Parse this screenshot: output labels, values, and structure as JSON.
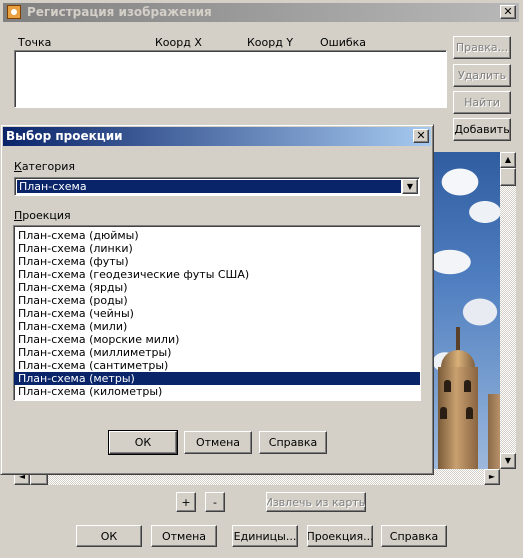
{
  "outer_window": {
    "title": "Регистрация изображения",
    "close_glyph": "✕",
    "columns": [
      "Точка",
      "Коорд X",
      "Коорд Y",
      "Ошибка"
    ],
    "side_buttons": {
      "help": "Правка...",
      "delete": "Удалить",
      "find": "Найти",
      "add": "Добавить"
    },
    "zoom_in": "+",
    "zoom_out": "-",
    "extract_from_map": "Извлечь из карты",
    "bottom_buttons": {
      "ok": "ОК",
      "cancel": "Отмена",
      "units": "Единицы...",
      "projection": "Проекция...",
      "help": "Справка"
    }
  },
  "projection_dialog": {
    "title": "Выбор проекции",
    "close_glyph": "✕",
    "category_label_first": "К",
    "category_label_rest": "атегория",
    "category_value": "План-схема",
    "projection_label_first": "П",
    "projection_label_rest": "роекция",
    "projections": [
      "План-схема (дюймы)",
      "План-схема (линки)",
      "План-схема (футы)",
      "План-схема (геодезические футы США)",
      "План-схема (ярды)",
      "План-схема (роды)",
      "План-схема (чейны)",
      "План-схема (мили)",
      "План-схема (морские мили)",
      "План-схема (миллиметры)",
      "План-схема (сантиметры)",
      "План-схема (метры)",
      "План-схема (километры)"
    ],
    "selected_projection": "План-схема (метры)",
    "buttons": {
      "ok": "ОК",
      "cancel": "Отмена",
      "help": "Справка"
    }
  },
  "icons": {
    "dropdown": "▼",
    "up": "▲",
    "down": "▼",
    "left": "◄",
    "right": "►"
  }
}
